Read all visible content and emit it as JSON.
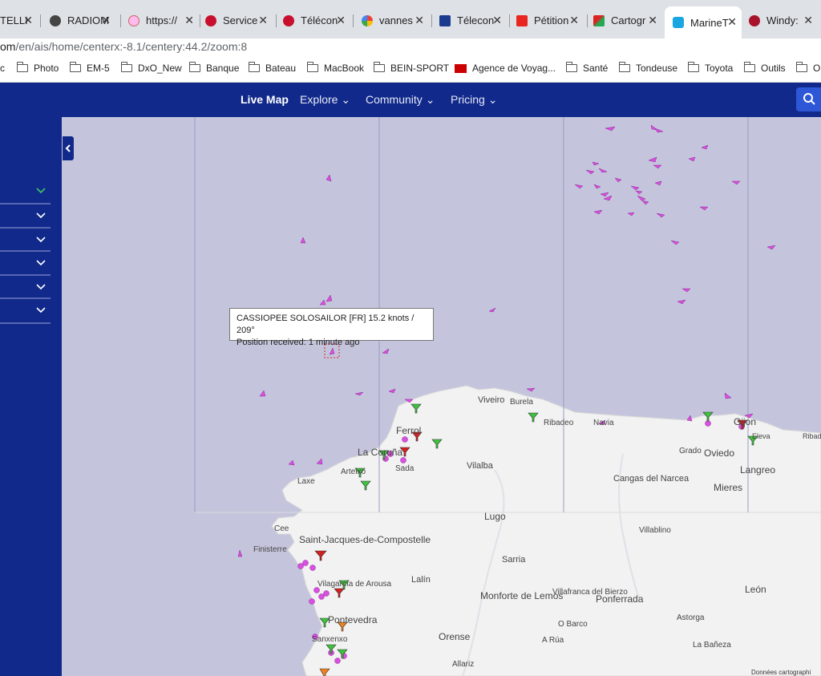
{
  "tabs": [
    {
      "label": "TELLI",
      "icon": "satellite-icon",
      "active": false
    },
    {
      "label": "RADIOM",
      "icon": "globe-icon",
      "active": false
    },
    {
      "label": "https://",
      "icon": "page-icon",
      "active": false
    },
    {
      "label": "Service",
      "icon": "red-logo-icon",
      "active": false
    },
    {
      "label": "Télécon",
      "icon": "red-logo-icon",
      "active": false
    },
    {
      "label": "vannes",
      "icon": "google-icon",
      "active": false
    },
    {
      "label": "Télecon",
      "icon": "c-logo-icon",
      "active": false
    },
    {
      "label": "Pétition",
      "icon": "c-red-logo-icon",
      "active": false
    },
    {
      "label": "Cartogr",
      "icon": "cartography-icon",
      "active": false
    },
    {
      "label": "MarineT",
      "icon": "marinetraffic-icon",
      "active": true
    },
    {
      "label": "Windy:",
      "icon": "windy-icon",
      "active": false
    }
  ],
  "address": {
    "prefix": "om",
    "path": "/en/ais/home/centerx:-8.1/centery:44.2/zoom:8"
  },
  "bookmarks": [
    "c",
    "Photo",
    "EM-5",
    "DxO_New",
    "Banque",
    "Bateau",
    "MacBook",
    "BEIN-SPORT",
    "Agence de Voyag...",
    "Santé",
    "Tondeuse",
    "Toyota",
    "Outils",
    "O"
  ],
  "nav": {
    "live_map": "Live Map",
    "explore": "Explore",
    "community": "Community",
    "pricing": "Pricing"
  },
  "tooltip": {
    "line1": "CASSIOPEE SOLOSAILOR [FR] 15.2 knots / 209°",
    "line2": "Position received: 1 minute ago"
  },
  "places": [
    "Viveiro",
    "Burela",
    "Ribadeo",
    "Navia",
    "Gijon",
    "Ferrol",
    "La Coruña",
    "Sada",
    "Arteixo",
    "Laxe",
    "Vilalba",
    "Grado",
    "Oviedo",
    "Langreo",
    "Cangas del Narcea",
    "Mieres",
    "Lugo",
    "Cee",
    "Finisterre",
    "Saint-Jacques-de-Compostelle",
    "Villablino",
    "Sarria",
    "Lalín",
    "Vilagarcía de Arousa",
    "Monforte de Lemos",
    "Villafranca del Bierzo",
    "Ponferrada",
    "León",
    "O Barco",
    "Astorga",
    "Pontevedra",
    "Sanxenxo",
    "Orense",
    "A Rúa",
    "La Bañeza",
    "Allariz",
    "Eleva",
    "Ribad"
  ],
  "attribution": "Données cartographi",
  "colors": {
    "nav": "#11298b",
    "sea": "#c4c5dc",
    "land": "#f2f2f2",
    "vessel": "#d94fe0",
    "port": "#2f9e2f"
  }
}
